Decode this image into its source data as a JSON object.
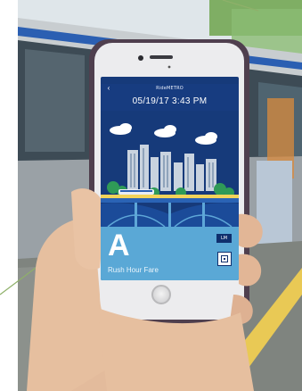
{
  "scene": {
    "description_colors": {
      "sky": "#dfe7ea",
      "train_body": "#c7cccf",
      "train_stripe": "#2a5fb3",
      "platform": "#8a8e8a",
      "platform_edge": "#f2cf5a",
      "phone_case": "#5b4a5a",
      "phone_body": "#e9e8ea",
      "skin": "#e6bfa0"
    }
  },
  "app": {
    "status_bar": {
      "carrier": "",
      "clock": "",
      "battery": ""
    },
    "header": {
      "back_icon": "chevron-left-icon",
      "agency": "RideMETRO",
      "subtitle": "",
      "timestamp": "05/19/17 3:43 PM"
    },
    "ticket": {
      "fare_letter": "A",
      "fare_name": "Rush Hour Fare",
      "zone_badge": "LM",
      "qr_icon": "qr-code-icon"
    },
    "colors": {
      "header_bg": "#173c80",
      "art_sky": "#163a7a",
      "fare_panel": "#5aa8d6",
      "badge_bg": "#0f2f6e"
    }
  }
}
